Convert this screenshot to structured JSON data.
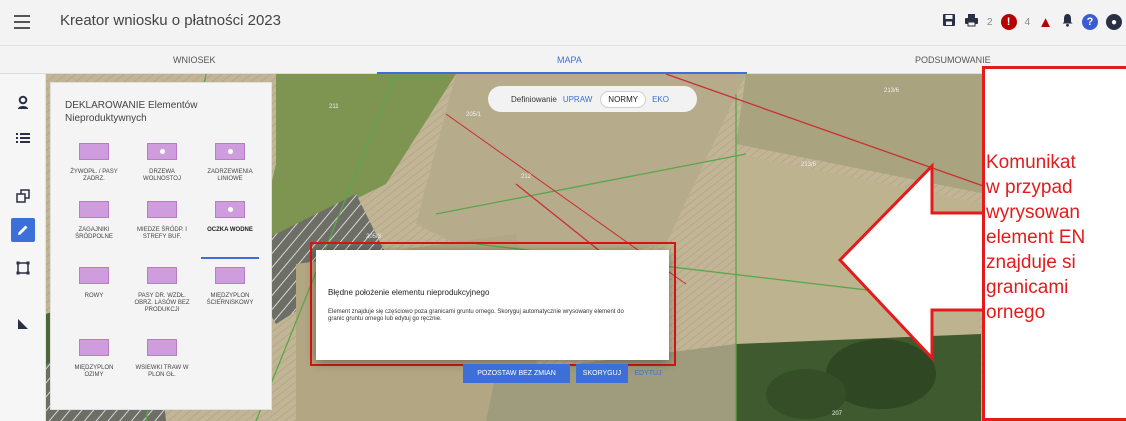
{
  "app": {
    "title": "Kreator wniosku o płatności 2023"
  },
  "topbar": {
    "icons": [
      "save-icon",
      "print-icon",
      "error-icon",
      "warning-icon",
      "notification-icon",
      "help-icon",
      "user-icon"
    ],
    "error_count": "2",
    "warning_count": "4"
  },
  "tabs": [
    {
      "label": "WNIOSEK",
      "active": false
    },
    {
      "label": "MAPA",
      "active": true
    },
    {
      "label": "PODSUMOWANIE",
      "active": false
    }
  ],
  "rail": {
    "icons": [
      "location-person-icon",
      "list-icon",
      "copy-icon",
      "pencil-icon",
      "selection-icon",
      "corner-icon"
    ]
  },
  "panel": {
    "title": "DEKLAROWANIE Elementów Nieproduktywnych",
    "elements": [
      {
        "label": "ŻYWOPŁ. / PASY ZADRZ.",
        "selected": false
      },
      {
        "label": "DRZEWA WOLNOSTOJ",
        "selected": false
      },
      {
        "label": "ZADRZEWIENIA LINIOWE",
        "selected": false
      },
      {
        "label": "ZAGAJNIKI ŚRÓDPOLNE",
        "selected": false
      },
      {
        "label": "MIEDZE ŚRÓDP. I STREFY BUF.",
        "selected": false
      },
      {
        "label": "OCZKA WODNE",
        "selected": true
      },
      {
        "label": "ROWY",
        "selected": false
      },
      {
        "label": "PASY DR. WZDŁ. OBRZ. LASÓW BEZ PRODUKCJI",
        "selected": false
      },
      {
        "label": "MIĘDZYPLON ŚCIERNISKOWY",
        "selected": false
      },
      {
        "label": "MIĘDZYPLON OZIMY",
        "selected": false
      },
      {
        "label": "WSIEWKI TRAW W PLON GŁ.",
        "selected": false
      }
    ]
  },
  "toggle": {
    "label": "Definiowanie",
    "options": [
      {
        "label": "UPRAW",
        "active": false
      },
      {
        "label": "NORMY",
        "active": true
      },
      {
        "label": "EKO",
        "active": false
      }
    ]
  },
  "map": {
    "parcel_labels": [
      "211",
      "205/1",
      "212",
      "213/6",
      "213/5",
      "205/3",
      "207"
    ]
  },
  "dialog": {
    "title": "Błędne położenie elementu nieprodukcyjnego",
    "text": "Element znajduje się częściowo poza granicami gruntu ornego. Skoryguj automatycznie wrysowany element do granic gruntu ornego lub edytuj go ręcznie.",
    "btn_keep": "POZOSTAW BEZ ZMIAN",
    "btn_fix": "SKORYGUJ",
    "btn_edit": "EDYTUJ"
  },
  "callout": {
    "text": "Komunikat\nw przypad\nwyrysowan\nelement EN\nznajduje si\ngranicami\nornego"
  },
  "colors": {
    "accent": "#3d6fd8",
    "highlight_red": "#e31b1b",
    "element_swatch": "#cf9ddd"
  }
}
